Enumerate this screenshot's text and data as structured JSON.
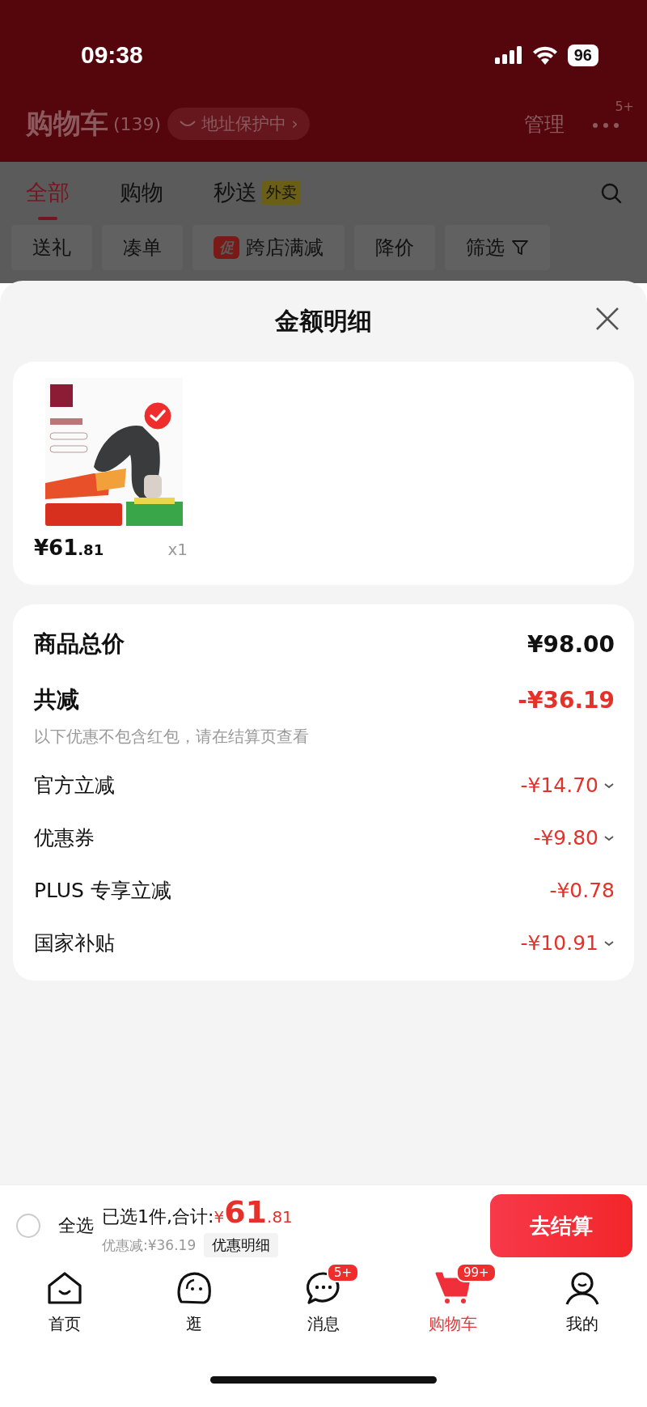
{
  "status_bar": {
    "time": "09:38",
    "battery": "96"
  },
  "header": {
    "title": "购物车",
    "count": "(139)",
    "address_badge": "地址保护中",
    "address_arrow": "›",
    "manage": "管理",
    "more_badge": "5+"
  },
  "tabs": [
    {
      "label": "全部",
      "selected": true
    },
    {
      "label": "购物",
      "selected": false
    },
    {
      "label": "秒送",
      "tag": "外卖",
      "selected": false
    }
  ],
  "filters": [
    {
      "label": "送礼",
      "kind": "plain"
    },
    {
      "label": "凑单",
      "kind": "plain"
    },
    {
      "label": "跨店满减",
      "kind": "promo",
      "tag": "促"
    },
    {
      "label": "降价",
      "kind": "plain"
    },
    {
      "label": "筛选",
      "kind": "filter"
    }
  ],
  "sheet": {
    "title": "金额明细",
    "products": [
      {
        "currency": "¥",
        "integer": "61",
        "decimal": ".81",
        "quantity": "x1",
        "selected": true
      }
    ],
    "total": {
      "label": "商品总价",
      "value": "¥98.00"
    },
    "discount": {
      "label": "共减",
      "value": "-¥36.19",
      "note": "以下优惠不包含红包，请在结算页查看"
    },
    "items": [
      {
        "label": "官方立减",
        "value": "-¥14.70",
        "expandable": true
      },
      {
        "label": "优惠券",
        "value": "-¥9.80",
        "expandable": true
      },
      {
        "label": "PLUS 专享立减",
        "value": "-¥0.78",
        "expandable": false
      },
      {
        "label": "国家补贴",
        "value": "-¥10.91",
        "expandable": true
      }
    ]
  },
  "bottom_bar": {
    "select_all": {
      "label": "全选",
      "checked": false
    },
    "summary": "已选1件,合计:",
    "currency": "¥",
    "integer": "61",
    "decimal": ".81",
    "saving": "优惠减:¥36.19",
    "detail_button": "优惠明细",
    "checkout_button": "去结算"
  },
  "nav": [
    {
      "label": "首页",
      "selected": false
    },
    {
      "label": "逛",
      "selected": false
    },
    {
      "label": "消息",
      "selected": false,
      "badge": "5+"
    },
    {
      "label": "购物车",
      "selected": true,
      "badge": "99+"
    },
    {
      "label": "我的",
      "selected": false
    }
  ]
}
